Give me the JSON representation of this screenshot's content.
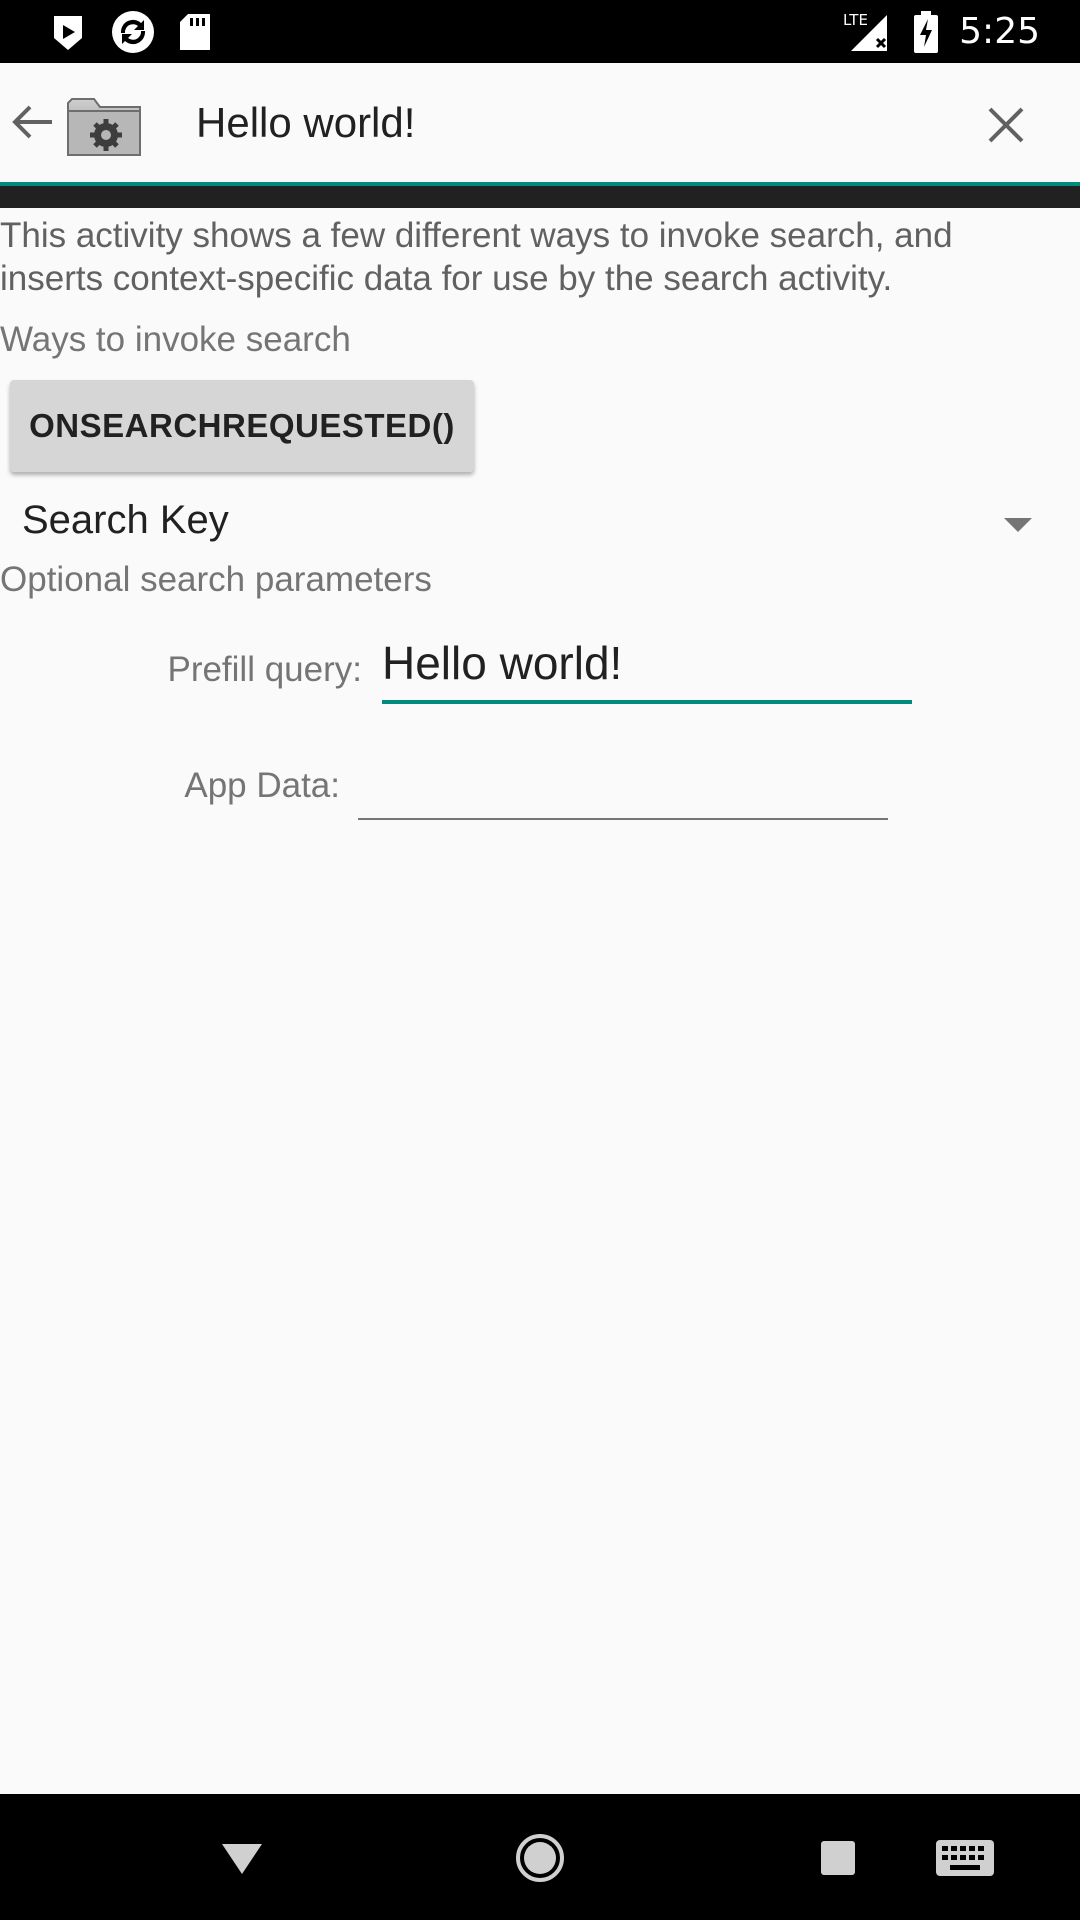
{
  "status_bar": {
    "time": "5:25",
    "network_label": "LTE",
    "left_icons": [
      "play-store-icon",
      "sync-icon",
      "sd-card-icon"
    ],
    "right_icons": [
      "signal-icon",
      "battery-charging-icon"
    ]
  },
  "search_bar": {
    "query": "Hello world!",
    "back_icon": "arrow-back-icon",
    "app_icon": "folder-gear-icon",
    "close_icon": "close-icon",
    "accent_color": "#008b7e"
  },
  "content": {
    "intro": "This activity shows a few different ways to invoke search, and inserts context-specific data for use by the search activity.",
    "section_invoke": "Ways to invoke search",
    "button_label": "ONSEARCHREQUESTED()",
    "spinner_value": "Search Key",
    "section_optional": "Optional search parameters",
    "prefill_label": "Prefill query:",
    "prefill_value": "Hello world!",
    "appdata_label": "App Data:",
    "appdata_value": ""
  },
  "nav_bar": {
    "icons": [
      "back-nav-icon",
      "home-nav-icon",
      "recents-nav-icon",
      "keyboard-icon"
    ]
  }
}
